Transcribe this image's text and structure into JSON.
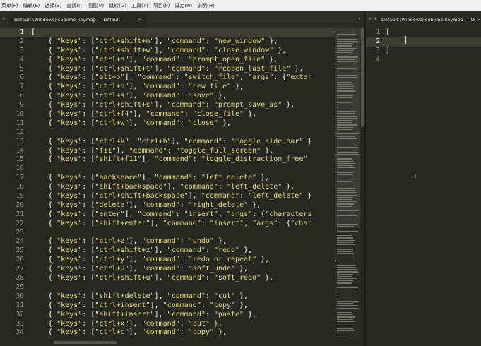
{
  "menu": [
    "菜单(F)",
    "编辑(E)",
    "选择(S)",
    "查找(I)",
    "视图(V)",
    "跳转(G)",
    "工具(T)",
    "项目(P)",
    "设定(N)",
    "说明(H)"
  ],
  "left_tab": {
    "label": "Default (Windows).sublime-keymap — Default",
    "close": "×",
    "arrows": "◂ ▸",
    "dropdown": "▾"
  },
  "right_tab": {
    "label": "Default (Windows).sublime-keymap — User",
    "close": "×",
    "arrows": "◂ ▸"
  },
  "left_lines": [
    "[",
    "\t{ \"keys\": [\"ctrl+shift+n\"], \"command\": \"new_window\" },",
    "\t{ \"keys\": [\"ctrl+shift+w\"], \"command\": \"close_window\" },",
    "\t{ \"keys\": [\"ctrl+o\"], \"command\": \"prompt_open_file\" },",
    "\t{ \"keys\": [\"ctrl+shift+t\"], \"command\": \"reopen_last_file\" },",
    "\t{ \"keys\": [\"alt+o\"], \"command\": \"switch_file\", \"args\": {\"exter",
    "\t{ \"keys\": [\"ctrl+n\"], \"command\": \"new_file\" },",
    "\t{ \"keys\": [\"ctrl+s\"], \"command\": \"save\" },",
    "\t{ \"keys\": [\"ctrl+shift+s\"], \"command\": \"prompt_save_as\" },",
    "\t{ \"keys\": [\"ctrl+f4\"], \"command\": \"close_file\" },",
    "\t{ \"keys\": [\"ctrl+w\"], \"command\": \"close\" },",
    "",
    "\t{ \"keys\": [\"ctrl+k\", \"ctrl+b\"], \"command\": \"toggle_side_bar\" }",
    "\t{ \"keys\": [\"f11\"], \"command\": \"toggle_full_screen\" },",
    "\t{ \"keys\": [\"shift+f11\"], \"command\": \"toggle_distraction_free\"",
    "",
    "\t{ \"keys\": [\"backspace\"], \"command\": \"left_delete\" },",
    "\t{ \"keys\": [\"shift+backspace\"], \"command\": \"left_delete\" },",
    "\t{ \"keys\": [\"ctrl+shift+backspace\"], \"command\": \"left_delete\" }",
    "\t{ \"keys\": [\"delete\"], \"command\": \"right_delete\" },",
    "\t{ \"keys\": [\"enter\"], \"command\": \"insert\", \"args\": {\"characters",
    "\t{ \"keys\": [\"shift+enter\"], \"command\": \"insert\", \"args\": {\"char",
    "",
    "\t{ \"keys\": [\"ctrl+z\"], \"command\": \"undo\" },",
    "\t{ \"keys\": [\"ctrl+shift+z\"], \"command\": \"redo\" },",
    "\t{ \"keys\": [\"ctrl+y\"], \"command\": \"redo_or_repeat\" },",
    "\t{ \"keys\": [\"ctrl+u\"], \"command\": \"soft_undo\" },",
    "\t{ \"keys\": [\"ctrl+shift+u\"], \"command\": \"soft_redo\" },",
    "",
    "\t{ \"keys\": [\"shift+delete\"], \"command\": \"cut\" },",
    "\t{ \"keys\": [\"ctrl+insert\"], \"command\": \"copy\" },",
    "\t{ \"keys\": [\"shift+insert\"], \"command\": \"paste\" },",
    "\t{ \"keys\": [\"ctrl+x\"], \"command\": \"cut\" },",
    "\t{ \"keys\": [\"ctrl+c\"], \"command\": \"copy\" },"
  ],
  "right_lines": [
    "[",
    "",
    "]",
    ""
  ],
  "colors": {
    "background": "#272822",
    "string": "#e6db74",
    "text": "#f8f8f2",
    "gutter": "#90908a",
    "active_line": "#3e3d32"
  }
}
